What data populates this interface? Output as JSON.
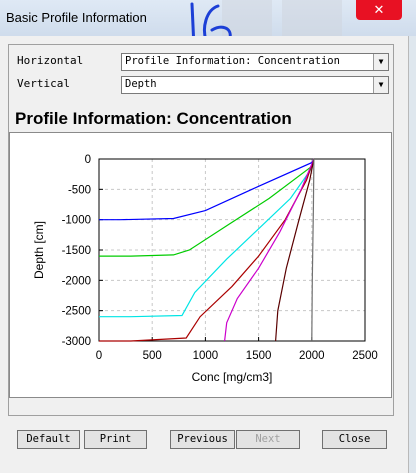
{
  "window": {
    "title": "Basic Profile Information",
    "close_glyph": "✕",
    "annotation_text": "16"
  },
  "axes_select": {
    "horizontal_label": "Horizontal",
    "horizontal_value": "Profile Information:  Concentration",
    "vertical_label": "Vertical",
    "vertical_value": "Depth"
  },
  "plot": {
    "title": "Profile Information:  Concentration"
  },
  "buttons": {
    "default": "Default",
    "print": "Print",
    "previous": "Previous",
    "next": "Next",
    "close": "Close"
  },
  "icons": {
    "dropdown": "chevron-down-icon",
    "close": "close-icon"
  },
  "colors": {
    "close_button": "#e81123"
  },
  "chart_data": {
    "type": "line",
    "xlabel": "Conc [mg/cm3]",
    "ylabel": "Depth [cm]",
    "xlim": [
      0,
      2500
    ],
    "ylim": [
      -3000,
      0
    ],
    "xticks": [
      0,
      500,
      1000,
      1500,
      2000,
      2500
    ],
    "yticks": [
      0,
      -500,
      -1000,
      -1500,
      -2000,
      -2500,
      -3000
    ],
    "grid": true,
    "series": [
      {
        "color": "#0000ff",
        "x": [
          0,
          200,
          700,
          1000,
          1500,
          2000,
          2020
        ],
        "y": [
          -1000,
          -1000,
          -980,
          -850,
          -450,
          -60,
          0
        ]
      },
      {
        "color": "#00cc00",
        "x": [
          0,
          300,
          700,
          850,
          1200,
          1600,
          2000,
          2020
        ],
        "y": [
          -1600,
          -1600,
          -1580,
          -1500,
          -1100,
          -650,
          -120,
          0
        ]
      },
      {
        "color": "#00e5e5",
        "x": [
          0,
          300,
          780,
          900,
          1200,
          1500,
          1800,
          2000,
          2020
        ],
        "y": [
          -2600,
          -2600,
          -2580,
          -2200,
          -1650,
          -1150,
          -650,
          -150,
          0
        ]
      },
      {
        "color": "#aa0000",
        "x": [
          0,
          300,
          820,
          950,
          1250,
          1500,
          1750,
          1950,
          2020
        ],
        "y": [
          -3000,
          -3000,
          -2950,
          -2600,
          -2100,
          -1600,
          -1000,
          -350,
          0
        ]
      },
      {
        "color": "#cc00cc",
        "x": [
          1180,
          1200,
          1300,
          1500,
          1700,
          1900,
          2020
        ],
        "y": [
          -3000,
          -2700,
          -2300,
          -1800,
          -1200,
          -500,
          0
        ]
      },
      {
        "color": "#5a0000",
        "x": [
          1660,
          1680,
          1760,
          1880,
          1980,
          2020
        ],
        "y": [
          -3000,
          -2500,
          -1800,
          -1000,
          -350,
          0
        ]
      },
      {
        "color": "#707070",
        "x": [
          2000,
          2005,
          2015,
          2020
        ],
        "y": [
          -3000,
          -2000,
          -800,
          0
        ]
      }
    ]
  }
}
